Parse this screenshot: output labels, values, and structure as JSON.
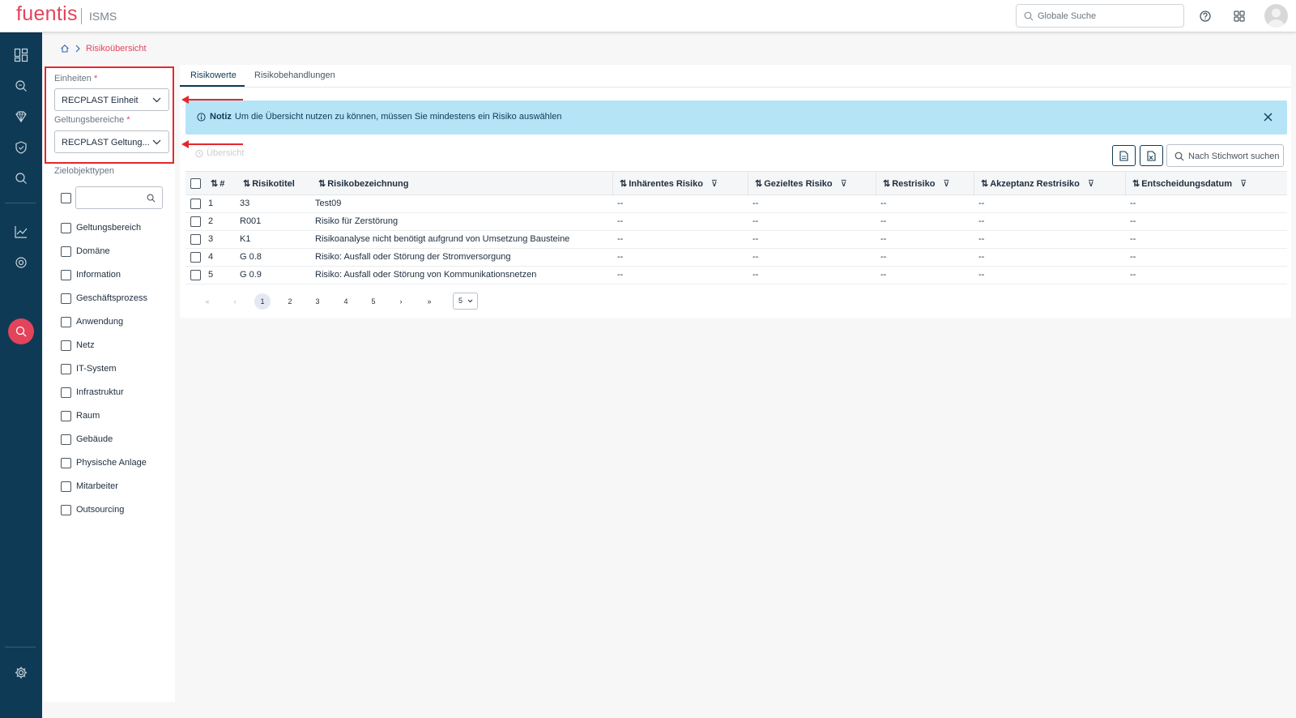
{
  "header": {
    "logo": "fuentis",
    "product": "ISMS",
    "global_search_placeholder": "Globale Suche"
  },
  "breadcrumb": {
    "current": "Risikoübersicht"
  },
  "filter": {
    "units_label": "Einheiten",
    "units_required": "*",
    "units_value": "RECPLAST Einheit",
    "scope_label": "Geltungsbereiche",
    "scope_required": "*",
    "scope_value": "RECPLAST Geltung...",
    "object_types_label": "Zielobjekttypen",
    "object_types": [
      "Geltungsbereich",
      "Domäne",
      "Information",
      "Geschäftsprozess",
      "Anwendung",
      "Netz",
      "IT-System",
      "Infrastruktur",
      "Raum",
      "Gebäude",
      "Physische Anlage",
      "Mitarbeiter",
      "Outsourcing"
    ]
  },
  "tabs": [
    {
      "label": "Risikowerte"
    },
    {
      "label": "Risikobehandlungen"
    }
  ],
  "notice": {
    "title": "Notiz",
    "text": "Um die Übersicht nutzen zu können, müssen Sie mindestens ein Risiko auswählen"
  },
  "toolbar": {
    "overview_label": "Übersicht",
    "search_placeholder": "Nach Stichwort suchen"
  },
  "table": {
    "headers": {
      "num": "#",
      "title": "Risikotitel",
      "designation": "Risikobezeichnung",
      "inherent": "Inhärentes Risiko",
      "targeted": "Gezieltes Risiko",
      "residual": "Restrisiko",
      "acceptance": "Akzeptanz Restrisiko",
      "decision_date": "Entscheidungsdatum"
    },
    "rows": [
      {
        "num": "1",
        "title": "33",
        "designation": "Test09",
        "inherent": "--",
        "targeted": "--",
        "residual": "--",
        "acceptance": "--",
        "decision_date": "--"
      },
      {
        "num": "2",
        "title": "R001",
        "designation": "Risiko für Zerstörung",
        "inherent": "--",
        "targeted": "--",
        "residual": "--",
        "acceptance": "--",
        "decision_date": "--"
      },
      {
        "num": "3",
        "title": "K1",
        "designation": "Risikoanalyse nicht benötigt aufgrund von Umsetzung Bausteine",
        "inherent": "--",
        "targeted": "--",
        "residual": "--",
        "acceptance": "--",
        "decision_date": "--"
      },
      {
        "num": "4",
        "title": "G 0.8",
        "designation": "Risiko: Ausfall oder Störung der Stromversorgung",
        "inherent": "--",
        "targeted": "--",
        "residual": "--",
        "acceptance": "--",
        "decision_date": "--"
      },
      {
        "num": "5",
        "title": "G 0.9",
        "designation": "Risiko: Ausfall oder Störung von Kommunikationsnetzen",
        "inherent": "--",
        "targeted": "--",
        "residual": "--",
        "acceptance": "--",
        "decision_date": "--"
      }
    ]
  },
  "pagination": {
    "first": "«",
    "prev": "‹",
    "pages": [
      "1",
      "2",
      "3",
      "4",
      "5"
    ],
    "current": "1",
    "next": "›",
    "last": "»",
    "page_size": "5"
  },
  "colors": {
    "brand": "#e3445b",
    "rail": "#0f3a55",
    "notice": "#b5e4f7",
    "highlight": "#e5272b"
  }
}
